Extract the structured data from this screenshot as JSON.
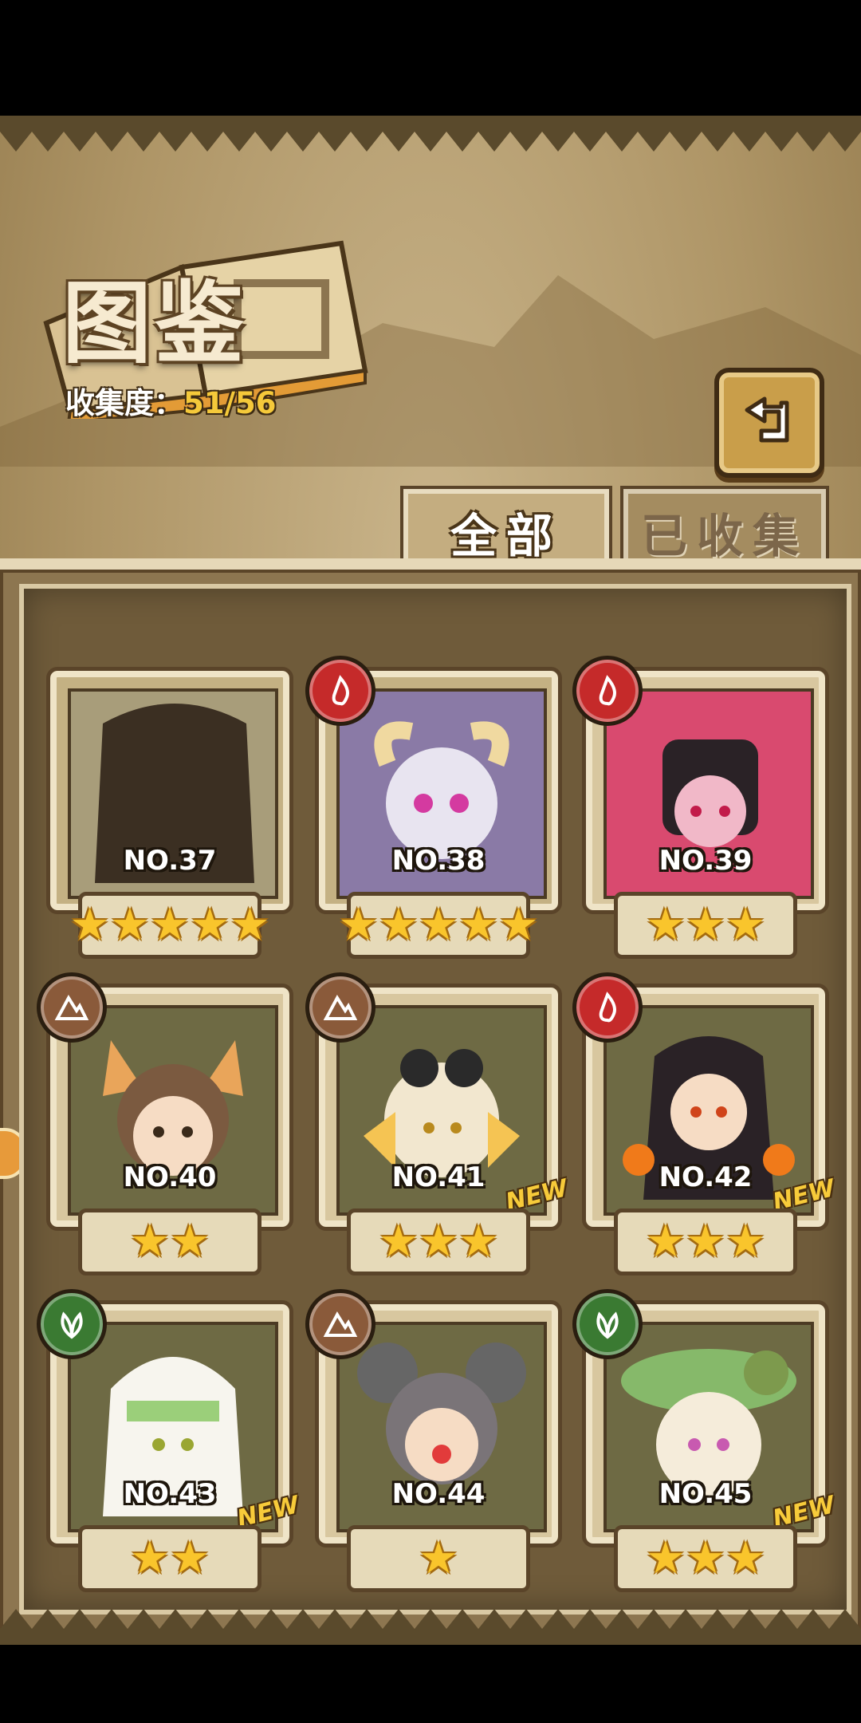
{
  "header": {
    "title": "图鉴",
    "collect_label": "收集度：",
    "collect_value": "51/56"
  },
  "tabs": [
    {
      "label": "全部",
      "active": true
    },
    {
      "label": "已收集",
      "active": false
    }
  ],
  "cards": [
    {
      "no": "NO.37",
      "stars": "★★★★★",
      "element": "none",
      "new": ""
    },
    {
      "no": "NO.38",
      "stars": "★★★★★",
      "element": "fire",
      "new": ""
    },
    {
      "no": "NO.39",
      "stars": "★★★",
      "element": "fire",
      "new": ""
    },
    {
      "no": "NO.40",
      "stars": "★★",
      "element": "earth",
      "new": ""
    },
    {
      "no": "NO.41",
      "stars": "★★★",
      "element": "earth",
      "new": "NEW"
    },
    {
      "no": "NO.42",
      "stars": "★★★",
      "element": "fire",
      "new": "NEW"
    },
    {
      "no": "NO.43",
      "stars": "★★",
      "element": "grass",
      "new": "NEW"
    },
    {
      "no": "NO.44",
      "stars": "★",
      "element": "earth",
      "new": ""
    },
    {
      "no": "NO.45",
      "stars": "★★★",
      "element": "grass",
      "new": "NEW"
    }
  ],
  "colors": {
    "fire": "#c52a2a",
    "earth": "#8a5a3a",
    "grass": "#3a7a32",
    "star": "#f9c52c",
    "accent": "#f5c93a"
  }
}
